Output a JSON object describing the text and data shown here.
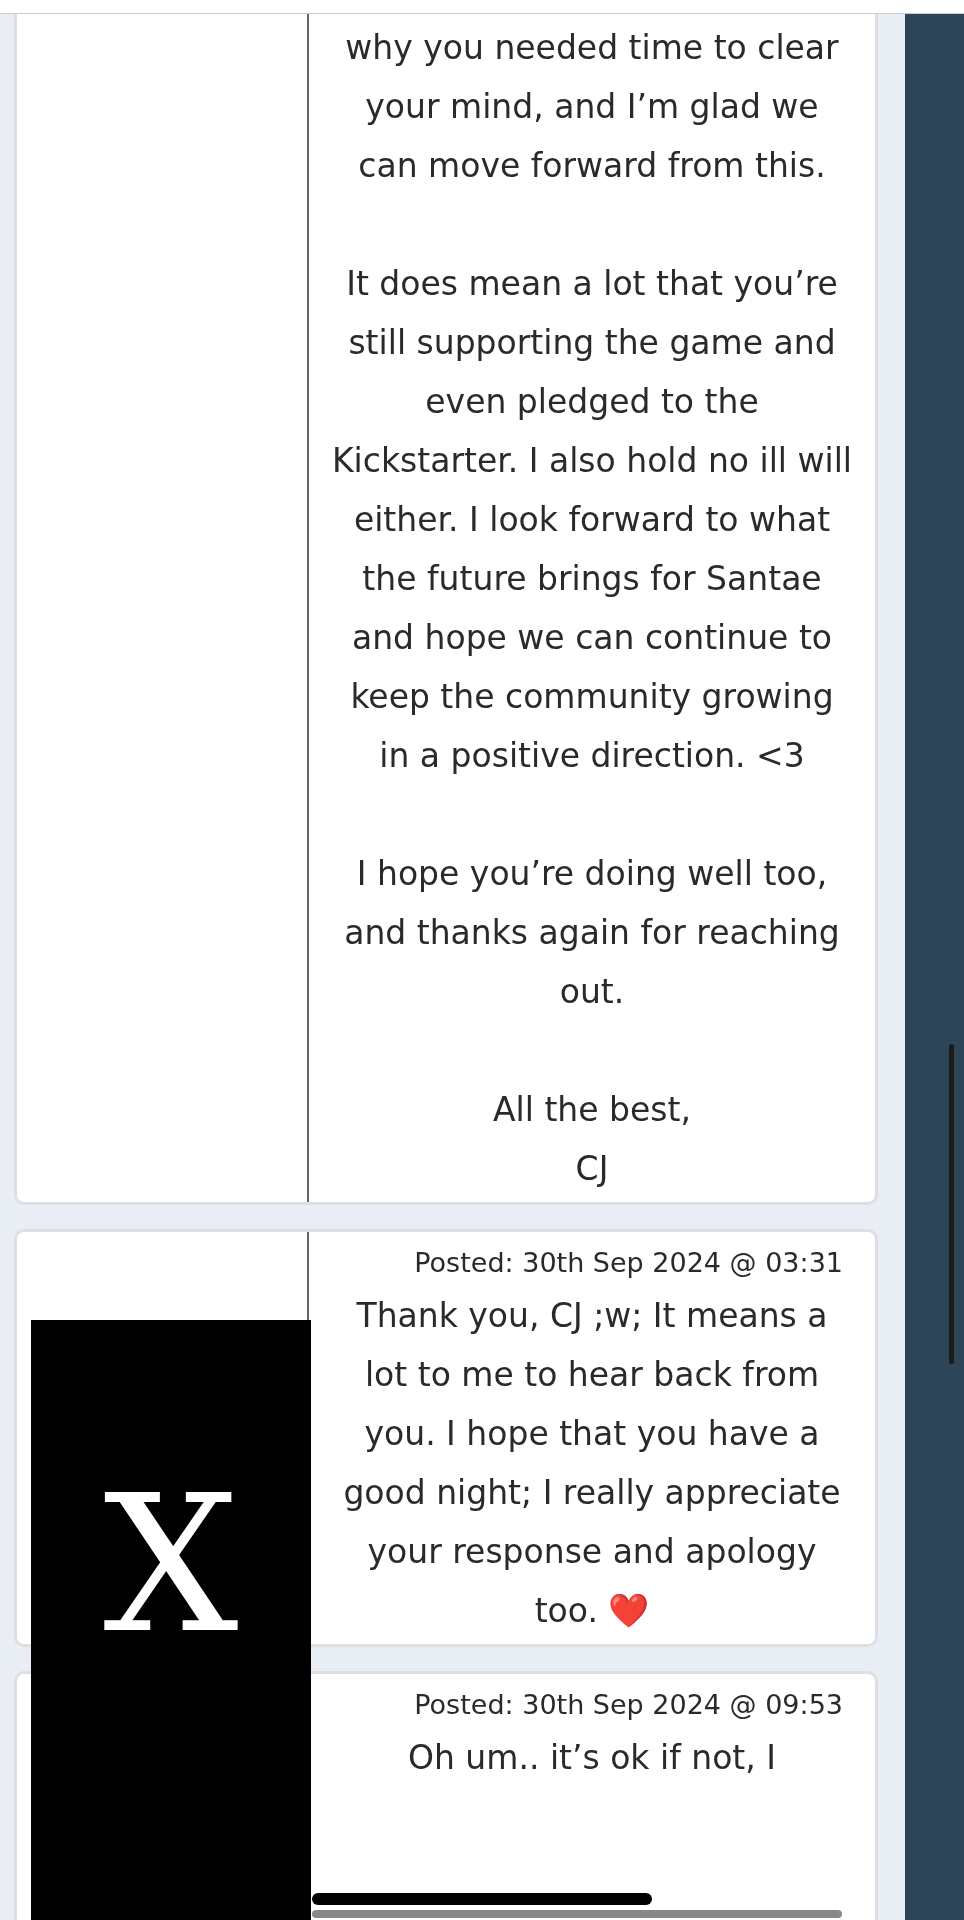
{
  "posts": [
    {
      "paragraphs": [
        "why you needed time to clear your mind, and I’m glad we can move forward from this.",
        "It does mean a lot that you’re still supporting the game and even pledged to the Kickstarter. I also hold no ill will either. I look forward to what the future brings for Santae and hope we can continue to keep the community growing in a positive direction. <3",
        "I hope you’re doing well too, and thanks again for reaching out."
      ],
      "signoff": [
        "All the best,",
        "CJ"
      ]
    },
    {
      "posted": "Posted: 30th Sep 2024 @ 03:31",
      "paragraphs": [
        "Thank you, CJ ;w; It means a lot to me to hear back from you. I hope that you have a good night; I really appreciate your response and apology too. ❤️"
      ]
    },
    {
      "posted": "Posted: 30th Sep 2024 @ 09:53",
      "paragraphs": [
        "Oh um.. it’s ok if not, I"
      ]
    }
  ],
  "redaction": {
    "mark": "X"
  }
}
